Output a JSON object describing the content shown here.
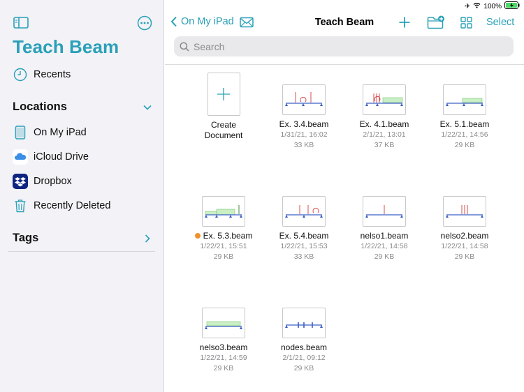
{
  "status_bar": {
    "battery": "100%"
  },
  "sidebar": {
    "app_title": "Teach Beam",
    "recents_label": "Recents",
    "locations_header": "Locations",
    "locations": [
      {
        "label": "On My iPad",
        "icon": "ipad-icon"
      },
      {
        "label": "iCloud Drive",
        "icon": "icloud-icon"
      },
      {
        "label": "Dropbox",
        "icon": "dropbox-icon"
      },
      {
        "label": "Recently Deleted",
        "icon": "trash-icon"
      }
    ],
    "tags_header": "Tags"
  },
  "toolbar": {
    "back_label": "On My iPad",
    "title": "Teach Beam",
    "select_label": "Select"
  },
  "search": {
    "placeholder": "Search",
    "value": ""
  },
  "accent_color": "#2aa0b8",
  "create": {
    "label_line1": "Create",
    "label_line2": "Document"
  },
  "files": [
    {
      "name": "Ex. 3.4.beam",
      "date": "1/31/21, 16:02",
      "size": "33 KB",
      "tag": null
    },
    {
      "name": "Ex. 4.1.beam",
      "date": "2/1/21, 13:01",
      "size": "37 KB",
      "tag": null
    },
    {
      "name": "Ex. 5.1.beam",
      "date": "1/22/21, 14:56",
      "size": "29 KB",
      "tag": null
    },
    {
      "name": "Ex. 5.3.beam",
      "date": "1/22/21, 15:51",
      "size": "29 KB",
      "tag": "#f0922a"
    },
    {
      "name": "Ex. 5.4.beam",
      "date": "1/22/21, 15:53",
      "size": "33 KB",
      "tag": null
    },
    {
      "name": "nelso1.beam",
      "date": "1/22/21, 14:58",
      "size": "29 KB",
      "tag": null
    },
    {
      "name": "nelso2.beam",
      "date": "1/22/21, 14:58",
      "size": "29 KB",
      "tag": null
    },
    {
      "name": "nelso3.beam",
      "date": "1/22/21, 14:59",
      "size": "29 KB",
      "tag": null
    },
    {
      "name": "nodes.beam",
      "date": "2/1/21, 09:12",
      "size": "29 KB",
      "tag": null
    }
  ]
}
